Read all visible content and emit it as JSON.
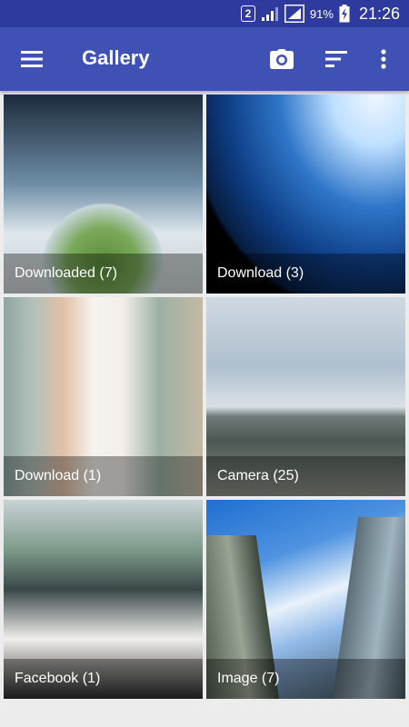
{
  "status_bar": {
    "sim_slot": "2",
    "battery_percent": "91%",
    "time": "21:26",
    "icons": [
      "sim-2-icon",
      "signal-icon",
      "signal-icon",
      "battery-charging-icon"
    ]
  },
  "app_bar": {
    "title": "Gallery",
    "icons": [
      "menu-icon",
      "camera-icon",
      "sort-icon",
      "more-vert-icon"
    ],
    "color": "#3f51b5"
  },
  "albums": [
    {
      "label": "Downloaded (7)"
    },
    {
      "label": "Download (3)"
    },
    {
      "label": "Download (1)"
    },
    {
      "label": "Camera (25)"
    },
    {
      "label": "Facebook (1)"
    },
    {
      "label": "Image (7)"
    }
  ],
  "colors": {
    "status_bar": "#2f3a9e",
    "app_bar": "#3f51b5",
    "background": "#ececec"
  }
}
